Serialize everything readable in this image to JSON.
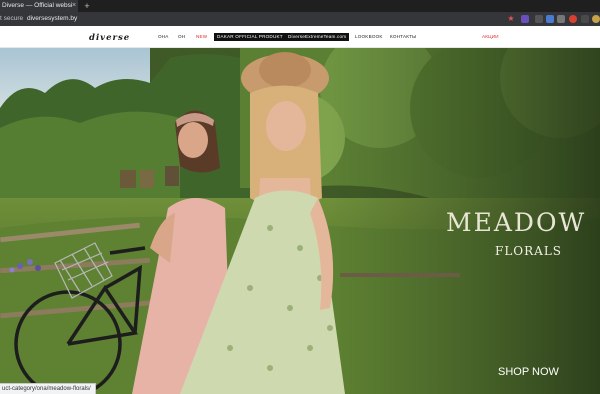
{
  "browser": {
    "tab_title": "Diverse — Official websi",
    "tab_close": "×",
    "new_tab": "+",
    "security_label": "t secure",
    "url": "diversesystem.by",
    "status_url": "uct-category/ona/meadow-florals/"
  },
  "header": {
    "logo": "diverse",
    "nav": [
      "ОНА",
      "ОН",
      "NEW",
      "DAKAR OFFICIAL PRODUKT",
      "DiverseExtremeTeam.com",
      "LOOKBOOK",
      "КОНТАКТЫ"
    ],
    "promo": "АКЦИИ"
  },
  "hero": {
    "title": "MEADOW",
    "subtitle": "FLORALS",
    "cta": "SHOP NOW"
  }
}
